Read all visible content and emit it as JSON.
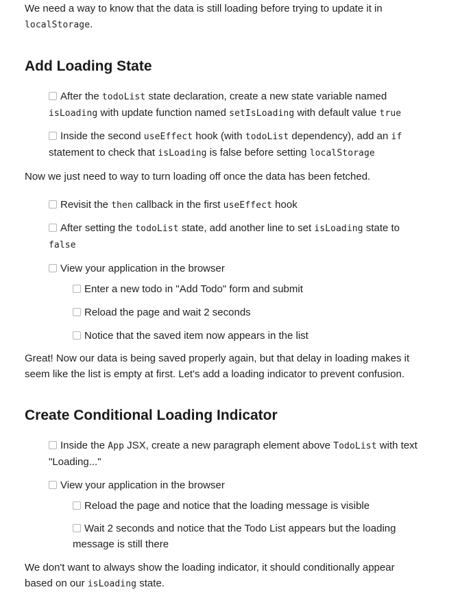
{
  "intro": {
    "text": "We need a way to know that the data is still loading before trying to update it in",
    "code": "localStorage",
    "end": "."
  },
  "section1": {
    "title": "Add Loading State",
    "item1": {
      "t1": "After the",
      "c1": "todoList",
      "t2": "state declaration, create a new state variable named",
      "c2": "isLoading",
      "t3": "with update function named",
      "c3": "setIsLoading",
      "t4": "with default value",
      "c4": "true"
    },
    "item2": {
      "t1": "Inside the second",
      "c1": "useEffect",
      "t2": "hook (with",
      "c2": "todoList",
      "t3": "dependency), add an",
      "c3": "if",
      "t4": "statement to check that",
      "c4": "isLoading",
      "t5": "is false before setting",
      "c5": "localStorage"
    },
    "para": "Now we just need to way to turn loading off once the data has been fetched.",
    "item3": {
      "t1": "Revisit the",
      "c1": "then",
      "t2": "callback in the first",
      "c2": "useEffect",
      "t3": "hook"
    },
    "item4": {
      "t1": "After setting the",
      "c1": "todoList",
      "t2": "state, add another line to set",
      "c2": "isLoading",
      "t3": "state to",
      "c3": "false"
    },
    "item5": "View your application in the browser",
    "sub1": "Enter a new todo in \"Add Todo\" form and submit",
    "sub2": "Reload the page and wait 2 seconds",
    "sub3": "Notice that the saved item now appears in the list",
    "para2_line1": "Great! Now our data is being saved properly again, but that delay in loading makes it",
    "para2_line2": "seem like the list is empty at first. Let's add a loading indicator to prevent confusion."
  },
  "section2": {
    "title": "Create Conditional Loading Indicator",
    "item1": {
      "t1": "Inside the",
      "c1": "App",
      "t2": "JSX, create a new paragraph element above",
      "c2": "TodoList",
      "t3": "with text",
      "t4": "\"Loading...\""
    },
    "item2": "View your application in the browser",
    "sub1": "Reload the page and notice that the loading message is visible",
    "sub2_line1": "Wait 2 seconds and notice that the Todo List appears but the loading",
    "sub2_line2": "message is still there",
    "para_line1": "We don't want to always show the loading indicator, it should conditionally appear",
    "para_line2": {
      "t1": "based on our",
      "c1": "isLoading",
      "t2": "state."
    }
  }
}
